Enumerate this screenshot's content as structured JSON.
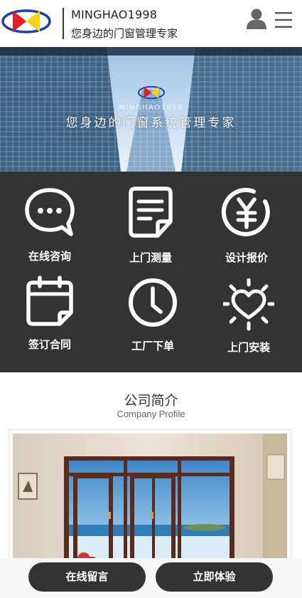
{
  "header": {
    "brand_name": "MINGHAO1998",
    "slogan": "您身边的门窗管理专家",
    "icons": {
      "logo": "minghao-logo",
      "user": "user-icon",
      "menu": "hamburger-menu-icon"
    },
    "logo_colors": {
      "ring": "#1a3fb0",
      "left": "#e41e26",
      "right": "#f7d417"
    }
  },
  "banner": {
    "brand": "MINGHAO1998",
    "slogan": "您身边的门窗系统管理专家"
  },
  "services": [
    {
      "label": "在线咨询",
      "icon": "chat-bubble-icon"
    },
    {
      "label": "上门测量",
      "icon": "document-icon"
    },
    {
      "label": "设计报价",
      "icon": "yen-icon"
    },
    {
      "label": "签订合同",
      "icon": "calendar-icon"
    },
    {
      "label": "工厂下单",
      "icon": "clock-icon"
    },
    {
      "label": "上门安装",
      "icon": "sun-heart-icon"
    }
  ],
  "profile": {
    "title": "公司简介",
    "subtitle": "Company Profile"
  },
  "bottom_bar": {
    "message_label": "在线留言",
    "experience_label": "立即体验"
  },
  "colors": {
    "dark": "#333333",
    "white": "#ffffff",
    "frame": "#5a2a1a"
  }
}
